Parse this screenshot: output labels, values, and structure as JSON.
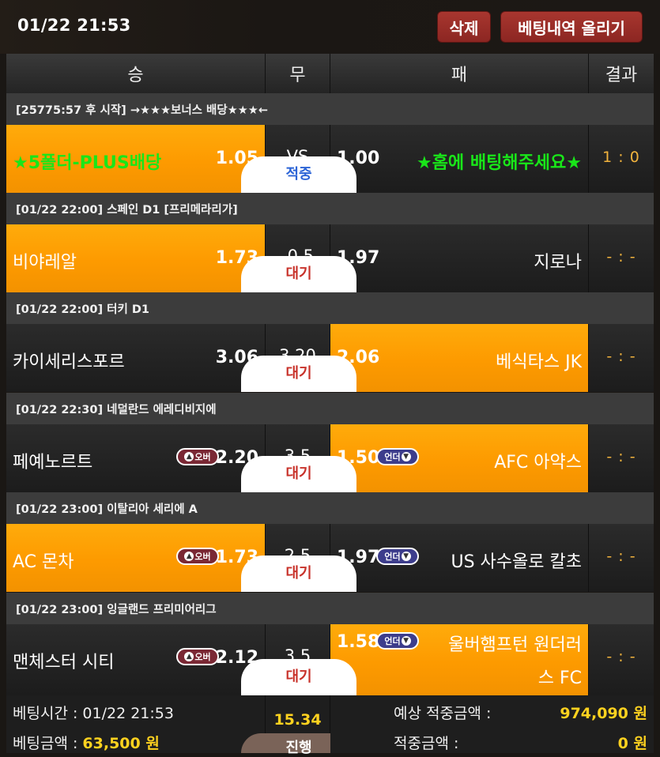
{
  "topbar": {
    "datetime": "01/22 21:53",
    "delete_label": "삭제",
    "upload_label": "베팅내역 올리기"
  },
  "header": {
    "win": "승",
    "draw": "무",
    "lose": "패",
    "result": "결과"
  },
  "matches": [
    {
      "league": "[25775:57 후 시작] →★★★보너스 배당★★★←",
      "home": "★5폴더-PLUS배당",
      "home_odds": "1.05",
      "mid": "VS",
      "away_odds": "1.00",
      "away": "★홈에 배팅해주세요★",
      "status": "적중",
      "result": "1 : 0"
    },
    {
      "league": "[01/22 22:00] 스페인 D1 [프리메라리가]",
      "home": "비야레알",
      "home_odds": "1.73",
      "mid": "-0.5",
      "away_odds": "1.97",
      "away": "지로나",
      "status": "대기",
      "result": "- : -"
    },
    {
      "league": "[01/22 22:00] 터키 D1",
      "home": "카이세리스포르",
      "home_odds": "3.06",
      "mid": "3.20",
      "away_odds": "2.06",
      "away": "베식타스 JK",
      "status": "대기",
      "result": "- : -"
    },
    {
      "league": "[01/22 22:30] 네덜란드 에레디비지에",
      "home": "페예노르트",
      "home_badge": "오버",
      "home_odds": "2.20",
      "mid": "3.5",
      "away_odds": "1.50",
      "away_badge": "언더",
      "away": "AFC 아약스",
      "status": "대기",
      "result": "- : -"
    },
    {
      "league": "[01/22 23:00] 이탈리아 세리에 A",
      "home": "AC 몬차",
      "home_badge": "오버",
      "home_odds": "1.73",
      "mid": "2.5",
      "away_odds": "1.97",
      "away_badge": "언더",
      "away": "US 사수올로 칼초",
      "status": "대기",
      "result": "- : -"
    },
    {
      "league": "[01/22 23:00] 잉글랜드 프리미어리그",
      "home": "맨체스터 시티",
      "home_badge": "오버",
      "home_odds": "2.12",
      "mid": "3.5",
      "away_odds": "1.58",
      "away_badge": "언더",
      "away_line1": "울버햄프턴 원더러",
      "away_line2": "스 FC",
      "status": "대기",
      "result": "- : -"
    }
  ],
  "footer": {
    "bet_time_label": "베팅시간 :",
    "bet_time": "01/22 21:53",
    "bet_amount_label": "베팅금액 :",
    "bet_amount": "63,500 원",
    "total_odds": "15.34",
    "status": "진행",
    "expected_label": "예상 적중금액 :",
    "expected": "974,090 원",
    "won_label": "적중금액 :",
    "won": "0 원"
  },
  "colors": {
    "selected": "#fd9a00",
    "green_text": "#19e619",
    "status_hit": "#2c64d6",
    "status_wait": "#c8322a",
    "result": "#f2b33d",
    "footer_value": "#ffd21f"
  }
}
